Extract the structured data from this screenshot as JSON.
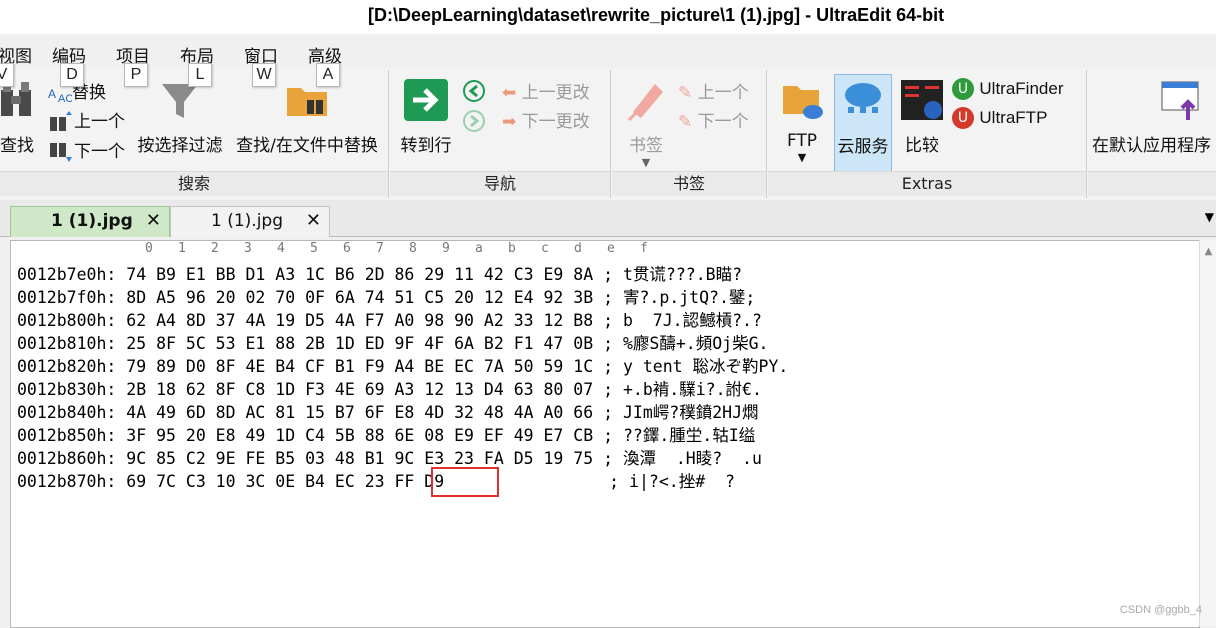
{
  "window": {
    "title": "[D:\\DeepLearning\\dataset\\rewrite_picture\\1 (1).jpg] - UltraEdit 64-bit"
  },
  "menu": [
    "视图",
    "编码",
    "项目",
    "布局",
    "窗口",
    "高级"
  ],
  "keytips": [
    "V",
    "D",
    "P",
    "L",
    "W",
    "A"
  ],
  "ribbon": {
    "search": {
      "label": "搜索",
      "find": "查找",
      "replace": "替换",
      "prev": "上一个",
      "next": "下一个",
      "filter": "按选择过滤",
      "find_in_files": "查找/在文件中替换"
    },
    "nav": {
      "label": "导航",
      "goto": "转到行",
      "prev_change": "上一更改",
      "next_change": "下一更改"
    },
    "bookmarks": {
      "label": "书签",
      "bookmark": "书签",
      "prev": "上一个",
      "next": "下一个"
    },
    "extras": {
      "label": "Extras",
      "ftp": "FTP",
      "cloud": "云服务",
      "compare": "比较",
      "finder": "UltraFinder",
      "ultraftp": "UltraFTP"
    },
    "open_default": "在默认应用程序"
  },
  "tabs": [
    {
      "label": "1 (1).jpg",
      "close": "✕"
    },
    {
      "label": "1 (1).jpg",
      "close": "✕"
    }
  ],
  "tab_overflow": "▼",
  "hex": {
    "ruler": [
      "0",
      "1",
      "2",
      "3",
      "4",
      "5",
      "6",
      "7",
      "8",
      "9",
      "a",
      "b",
      "c",
      "d",
      "e",
      "f"
    ],
    "rows": [
      {
        "addr": "0012b7e0h:",
        "bytes": "74 B9 E1 BB D1 A3 1C B6 2D 86 29 11 42 C3 E9 8A",
        "text": "; t贯谎???.B瞄?"
      },
      {
        "addr": "0012b7f0h:",
        "bytes": "8D A5 96 20 02 70 0F 6A 74 51 C5 20 12 E4 92 3B",
        "text": "; 寈?.p.jtQ?.鐾;"
      },
      {
        "addr": "0012b800h:",
        "bytes": "62 A4 8D 37 4A 19 D5 4A F7 A0 98 90 A2 33 12 B8",
        "text": "; b  7J.認鳡槓?.?"
      },
      {
        "addr": "0012b810h:",
        "bytes": "25 8F 5C 53 E1 88 2B 1D ED 9F 4F 6A B2 F1 47 0B",
        "text": "; %廫S醻+.頻Oj柴G."
      },
      {
        "addr": "0012b820h:",
        "bytes": "79 89 D0 8F 4E B4 CF B1 F9 A4 BE EC 7A 50 59 1C",
        "text": "; y tent 聡冰ぞ靮PY."
      },
      {
        "addr": "0012b830h:",
        "bytes": "2B 18 62 8F C8 1D F3 4E 69 A3 12 13 D4 63 80 07",
        "text": "; +.b褃.驜i?.詂€."
      },
      {
        "addr": "0012b840h:",
        "bytes": "4A 49 6D 8D AC 81 15 B7 6F E8 4D 32 48 4A A0 66",
        "text": "; JIm崿?穙鐼2HJ燜"
      },
      {
        "addr": "0012b850h:",
        "bytes": "3F 95 20 E8 49 1D C4 5B 88 6E 08 E9 EF 49 E7 CB",
        "text": "; ??鐸.腫坣.轱I缢"
      },
      {
        "addr": "0012b860h:",
        "bytes": "9C 85 C2 9E FE B5 03 48 B1 9C E3 23 FA D5 19 75",
        "text": "; 渙潭  .H睖?  .u"
      },
      {
        "addr": "0012b870h:",
        "bytes": "69 7C C3 10 3C 0E B4 EC 23 FF D9",
        "text": "; i|?<.挫#  ?"
      }
    ]
  },
  "watermark": "CSDN @ggbb_4",
  "colors": {
    "accent": "#3a7fd5",
    "highlight_border": "#e03030",
    "active_tab": "#cfe8c8"
  }
}
